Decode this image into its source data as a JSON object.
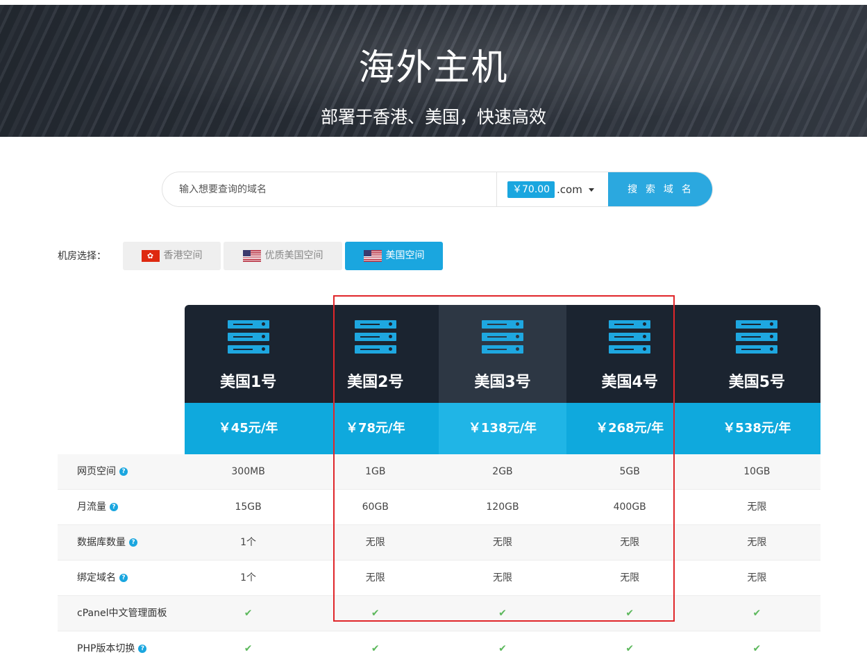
{
  "hero": {
    "title": "海外主机",
    "subtitle": "部署于香港、美国，快速高效"
  },
  "search": {
    "placeholder": "输入想要查询的域名",
    "value": "",
    "price": "￥70.00",
    "tld": ".com",
    "button_label": "搜 索 域 名"
  },
  "room": {
    "label": "机房选择：",
    "tabs": [
      {
        "label": "香港空间",
        "flag": "hk-flag",
        "active": false
      },
      {
        "label": "优质美国空间",
        "flag": "us-flag",
        "active": false
      },
      {
        "label": "美国空间",
        "flag": "us-flag",
        "active": true
      }
    ]
  },
  "plans": [
    {
      "name": "美国1号",
      "price": "￥45元/年"
    },
    {
      "name": "美国2号",
      "price": "￥78元/年"
    },
    {
      "name": "美国3号",
      "price": "￥138元/年"
    },
    {
      "name": "美国4号",
      "price": "￥268元/年"
    },
    {
      "name": "美国5号",
      "price": "￥538元/年"
    }
  ],
  "features": [
    {
      "name": "网页空间",
      "help": true,
      "values": [
        "300MB",
        "1GB",
        "2GB",
        "5GB",
        "10GB"
      ]
    },
    {
      "name": "月流量",
      "help": true,
      "values": [
        "15GB",
        "60GB",
        "120GB",
        "400GB",
        "无限"
      ]
    },
    {
      "name": "数据库数量",
      "help": true,
      "values": [
        "1个",
        "无限",
        "无限",
        "无限",
        "无限"
      ]
    },
    {
      "name": "绑定域名",
      "help": true,
      "values": [
        "1个",
        "无限",
        "无限",
        "无限",
        "无限"
      ]
    },
    {
      "name": "cPanel中文管理面板",
      "help": false,
      "values": [
        "✔",
        "✔",
        "✔",
        "✔",
        "✔"
      ]
    },
    {
      "name": "PHP版本切换",
      "help": true,
      "values": [
        "✔",
        "✔",
        "✔",
        "✔",
        "✔"
      ]
    }
  ],
  "colors": {
    "accent": "#1aa6df",
    "plan_header": "#1b2430",
    "plan_price": "#0fa9dd",
    "check": "#5cb85c",
    "highlight": "#e0262a"
  }
}
